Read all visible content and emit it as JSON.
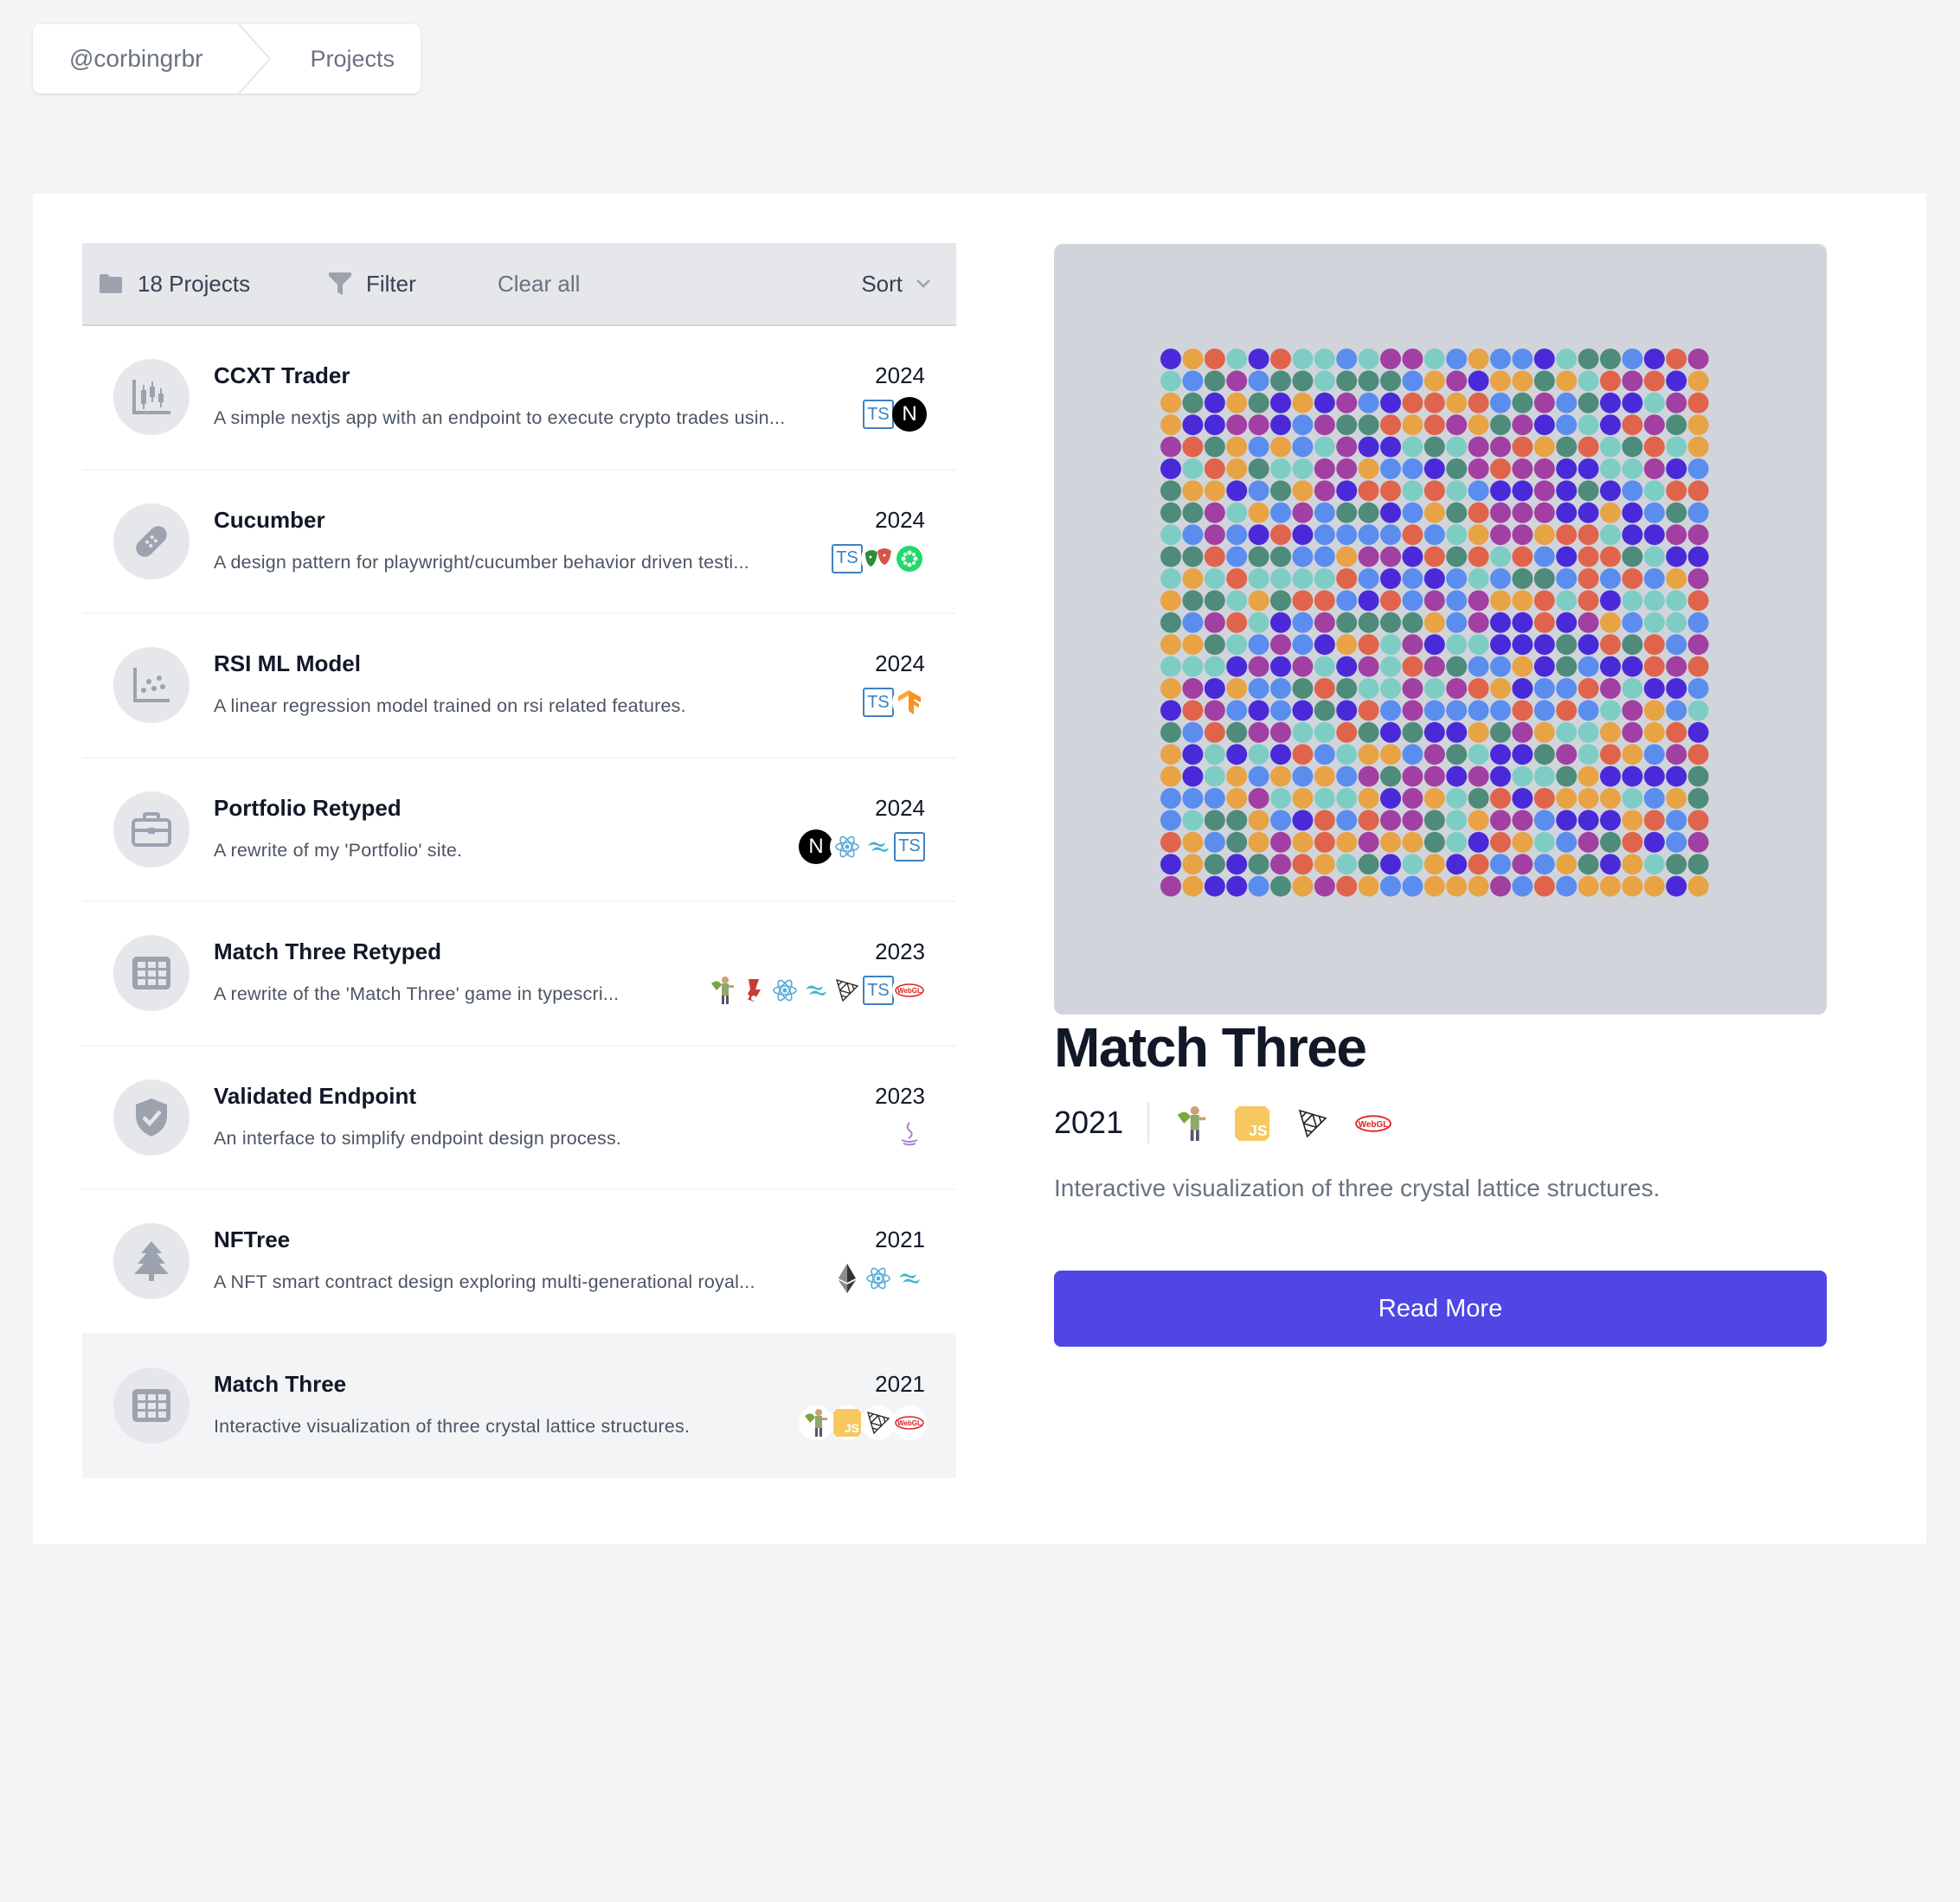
{
  "breadcrumb": {
    "user": "@corbingrbr",
    "page": "Projects"
  },
  "toolbar": {
    "count_label": "18 Projects",
    "filter_label": "Filter",
    "clear_label": "Clear all",
    "sort_label": "Sort"
  },
  "projects": [
    {
      "title": "CCXT Trader",
      "year": "2024",
      "description": "A simple nextjs app with an endpoint to execute crypto trades usin...",
      "icon": "candlestick-chart-icon",
      "tech": [
        "typescript",
        "nextjs"
      ]
    },
    {
      "title": "Cucumber",
      "year": "2024",
      "description": "A design pattern for playwright/cucumber behavior driven testi...",
      "icon": "bandage-icon",
      "tech": [
        "typescript",
        "playwright",
        "cucumber"
      ]
    },
    {
      "title": "RSI ML Model",
      "year": "2024",
      "description": "A linear regression model trained on rsi related features.",
      "icon": "scatter-chart-icon",
      "tech": [
        "typescript",
        "tensorflow"
      ]
    },
    {
      "title": "Portfolio Retyped",
      "year": "2024",
      "description": "A rewrite of my 'Portfolio' site.",
      "icon": "briefcase-icon",
      "tech": [
        "nextjs",
        "react",
        "tailwind",
        "typescript"
      ]
    },
    {
      "title": "Match Three Retyped",
      "year": "2023",
      "description": "A rewrite of the 'Match Three' game in typescri...",
      "icon": "grid-icon",
      "tech": [
        "superhero",
        "jest",
        "react",
        "tailwind",
        "threejs",
        "typescript",
        "webgl"
      ]
    },
    {
      "title": "Validated Endpoint",
      "year": "2023",
      "description": "An interface to simplify endpoint design process.",
      "icon": "shield-check-icon",
      "tech": [
        "java"
      ]
    },
    {
      "title": "NFTree",
      "year": "2021",
      "description": "A NFT smart contract design exploring multi-generational royal...",
      "icon": "tree-icon",
      "tech": [
        "ethereum",
        "react",
        "tailwind"
      ]
    },
    {
      "title": "Match Three",
      "year": "2021",
      "description": "Interactive visualization of three crystal lattice structures.",
      "icon": "grid-icon",
      "tech": [
        "superhero",
        "javascript",
        "threejs",
        "webgl"
      ],
      "selected": true
    }
  ],
  "detail": {
    "title": "Match Three",
    "year": "2021",
    "description": "Interactive visualization of three crystal lattice structures.",
    "button_label": "Read More",
    "tech": [
      "superhero",
      "javascript",
      "threejs",
      "webgl"
    ]
  },
  "tech_labels": {
    "typescript": "TS",
    "nextjs": "N",
    "javascript": "JS",
    "webgl": "WebGL"
  },
  "colors": {
    "accent": "#4f46e5",
    "grid_palette": [
      "#5b8def",
      "#a23fa2",
      "#e8a345",
      "#e0644b",
      "#4a2ad8",
      "#4f8b7a",
      "#7ecdc4"
    ]
  }
}
